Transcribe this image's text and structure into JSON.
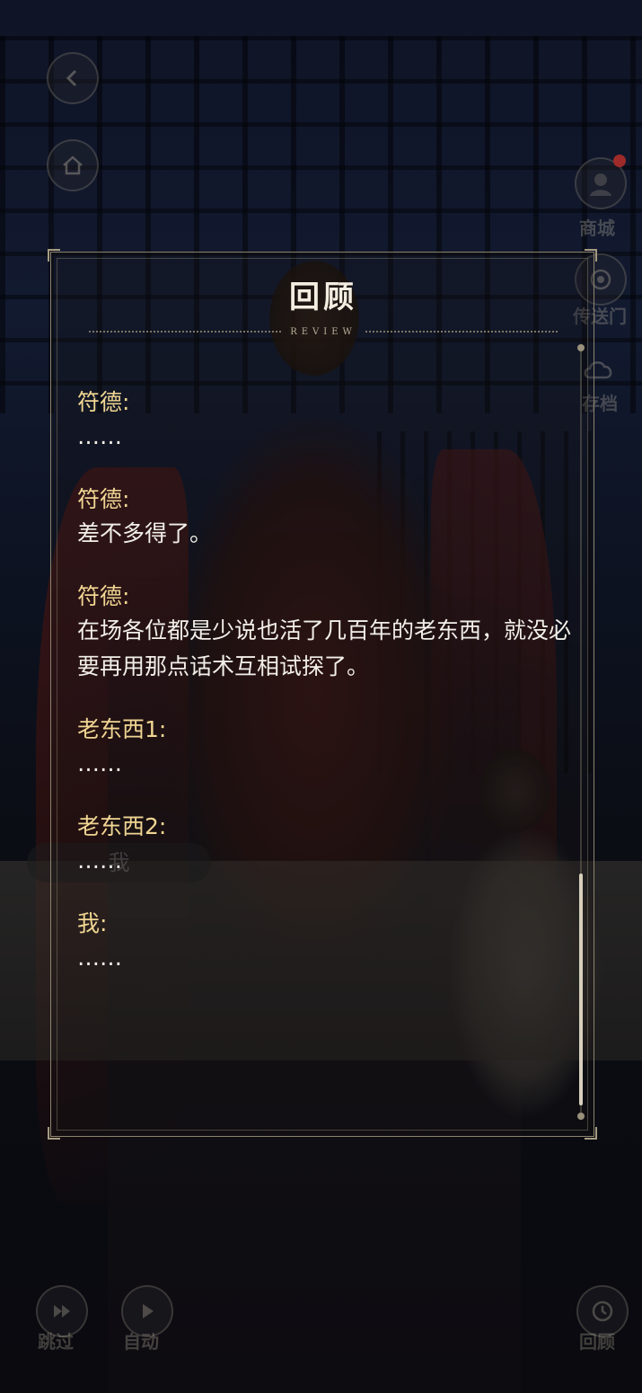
{
  "scene": {
    "name_box": "我"
  },
  "hud": {
    "top_right": [
      {
        "label": "商城",
        "icon": "avatar-icon"
      },
      {
        "label": "传送门",
        "icon": "portal-icon"
      },
      {
        "label": "存档",
        "icon": "cloud-save-icon"
      }
    ],
    "bottom": {
      "skip": "跳过",
      "auto": "自动",
      "review": "回顾"
    }
  },
  "review": {
    "title": "回顾",
    "subtitle": "REVIEW",
    "entries": [
      {
        "speaker": "符德:",
        "text": "……"
      },
      {
        "speaker": "符德:",
        "text": "差不多得了。"
      },
      {
        "speaker": "符德:",
        "text": "在场各位都是少说也活了几百年的老东西，就没必要再用那点话术互相试探了。"
      },
      {
        "speaker": "老东西1:",
        "text": "……"
      },
      {
        "speaker": "老东西2:",
        "text": "……"
      },
      {
        "speaker": "我:",
        "text": "……"
      }
    ]
  },
  "colors": {
    "speaker": "#f0d592",
    "text": "#f2efe8",
    "frame": "#8c836f"
  }
}
